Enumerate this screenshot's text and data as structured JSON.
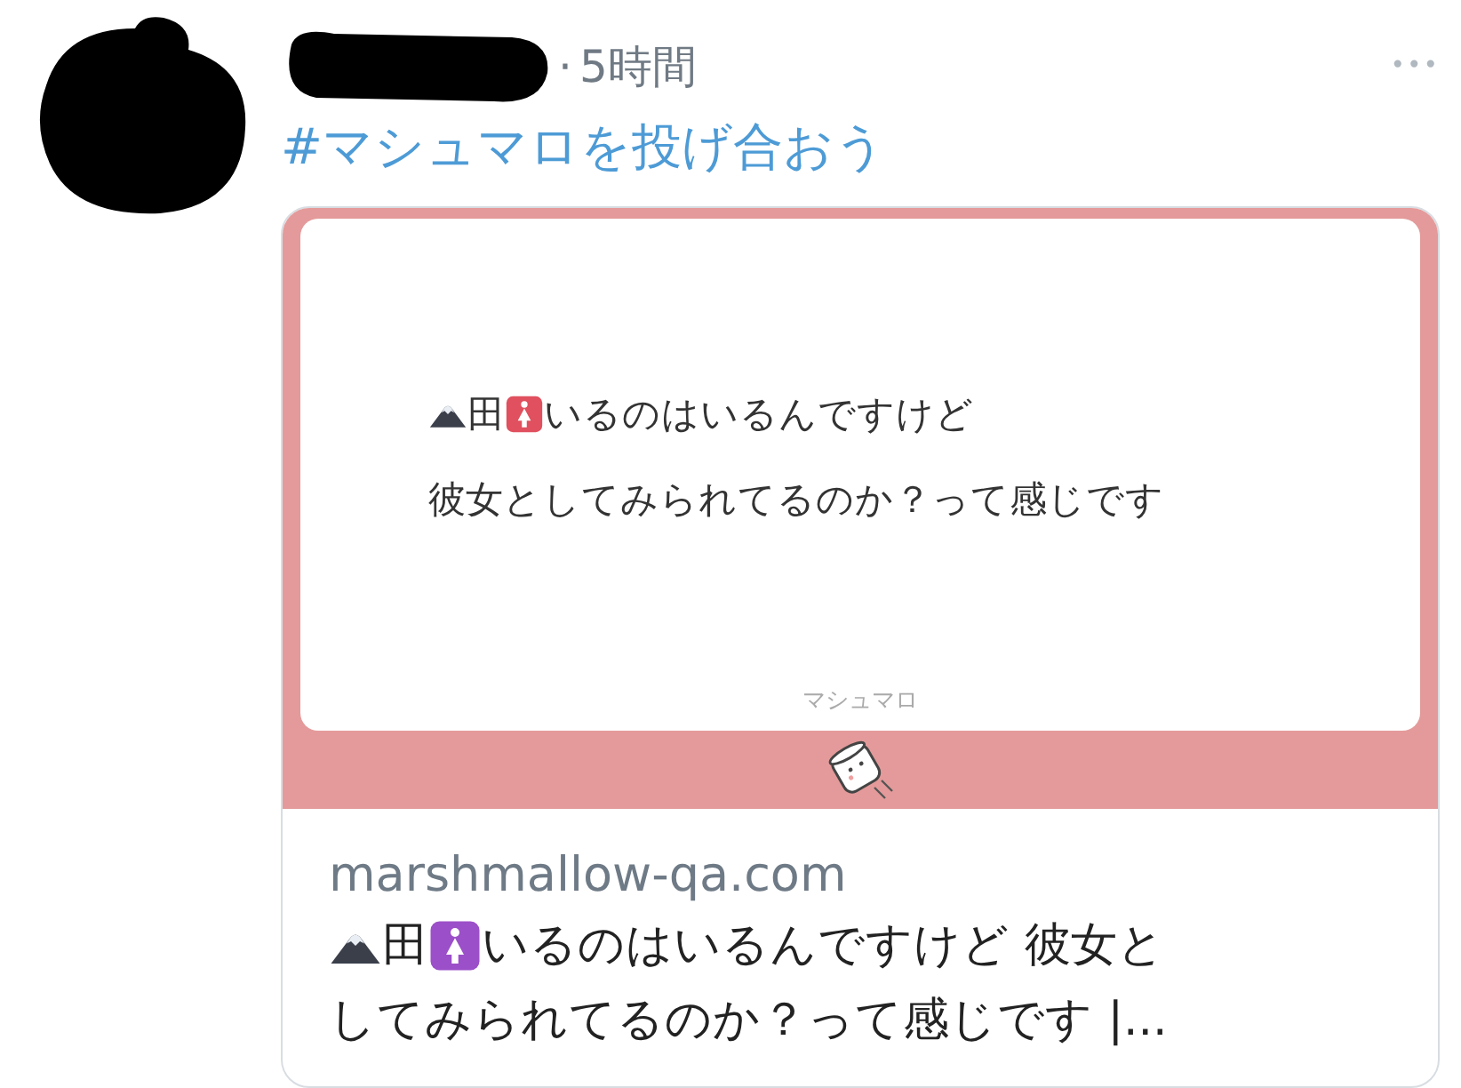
{
  "tweet": {
    "time": "5時間",
    "separator": "·",
    "hashtag": "#マシュマロを投げ合おう",
    "more": "•••",
    "card": {
      "question_lines": [
        [
          {
            "kind": "mountain"
          },
          {
            "kind": "text",
            "text": "田"
          },
          {
            "kind": "women"
          },
          {
            "kind": "text",
            "text": "いるのはいるんですけど"
          }
        ],
        [
          {
            "kind": "text",
            "text": "彼女としてみられてるのか？って感じです"
          }
        ]
      ],
      "brand": "マシュマロ",
      "domain": "marshmallow-qa.com",
      "description_lines": [
        [
          {
            "kind": "mountain"
          },
          {
            "kind": "text",
            "text": "田"
          },
          {
            "kind": "women"
          },
          {
            "kind": "text",
            "text": "いるのはいるんですけど 彼女と"
          }
        ],
        [
          {
            "kind": "text",
            "text": "してみられてるのか？って感じです |..."
          }
        ]
      ]
    }
  }
}
